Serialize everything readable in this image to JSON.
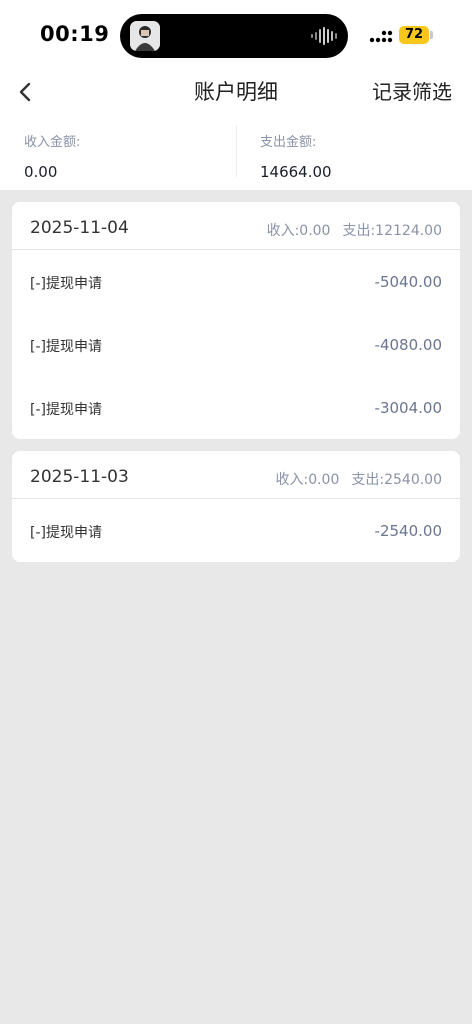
{
  "status_bar": {
    "time": "00:19",
    "battery": "72",
    "battery_color": "#f7c81b"
  },
  "nav": {
    "title": "账户明细",
    "filter_label": "记录筛选"
  },
  "summary": {
    "income_label": "收入金额:",
    "income_value": "0.00",
    "expense_label": "支出金额:",
    "expense_value": "14664.00"
  },
  "days": [
    {
      "date": "2025-11-04",
      "income": "收入:0.00",
      "expense": "支出:12124.00",
      "records": [
        {
          "label": "[-]提现申请",
          "amount": "-5040.00"
        },
        {
          "label": "[-]提现申请",
          "amount": "-4080.00"
        },
        {
          "label": "[-]提现申请",
          "amount": "-3004.00"
        }
      ]
    },
    {
      "date": "2025-11-03",
      "income": "收入:0.00",
      "expense": "支出:2540.00",
      "records": [
        {
          "label": "[-]提现申请",
          "amount": "-2540.00"
        }
      ]
    }
  ],
  "icons": {
    "back": "chevron-left-icon",
    "signal": "signal-icon",
    "battery": "battery-icon",
    "avatar": "avatar",
    "audio": "audio-wave-icon"
  }
}
